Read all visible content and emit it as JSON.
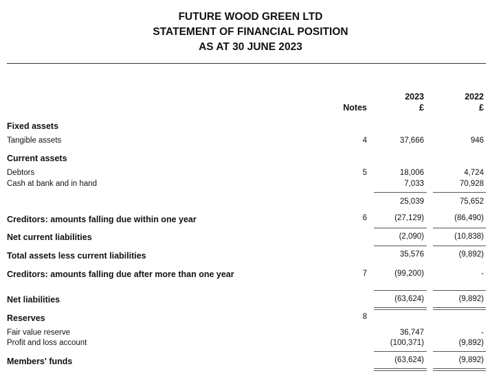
{
  "header": {
    "company": "FUTURE WOOD GREEN LTD",
    "statement": "STATEMENT OF FINANCIAL POSITION",
    "date": "AS AT 30 JUNE 2023"
  },
  "columns": {
    "notes": "Notes",
    "year1": "2023",
    "year2": "2022",
    "currency1": "£",
    "currency2": "£"
  },
  "rows": [
    {
      "label": "Fixed assets",
      "bold": true
    },
    {
      "label": "Tangible assets",
      "note": "4",
      "v2023": "37,666",
      "v2022": "946"
    },
    {
      "label": "Current assets",
      "bold": true
    },
    {
      "label": "Debtors",
      "note": "5",
      "v2023": "18,006",
      "v2022": "4,724"
    },
    {
      "label": "Cash at bank and in hand",
      "v2023": "7,033",
      "v2022": "70,928"
    },
    {
      "label": "",
      "v2023": "25,039",
      "v2022": "75,652"
    },
    {
      "label": "Creditors: amounts falling due within one year",
      "bold": true,
      "note": "6",
      "v2023": "(27,129)",
      "v2022": "(86,490)"
    },
    {
      "label": "Net current liabilities",
      "bold": true,
      "v2023": "(2,090)",
      "v2022": "(10,838)"
    },
    {
      "label": "Total assets less current liabilities",
      "bold": true,
      "v2023": "35,576",
      "v2022": "(9,892)"
    },
    {
      "label": "Creditors: amounts falling due after more than one year",
      "bold": true,
      "note": "7",
      "v2023": "(99,200)",
      "v2022": "-"
    },
    {
      "label": "Net liabilities",
      "bold": true,
      "v2023": "(63,624)",
      "v2022": "(9,892)"
    },
    {
      "label": "Reserves",
      "bold": true,
      "note": "8"
    },
    {
      "label": "Fair value reserve",
      "v2023": "36,747",
      "v2022": "-"
    },
    {
      "label": "Profit and loss account",
      "v2023": "(100,371)",
      "v2022": "(9,892)"
    },
    {
      "label": "Members' funds",
      "bold": true,
      "v2023": "(63,624)",
      "v2022": "(9,892)"
    }
  ]
}
